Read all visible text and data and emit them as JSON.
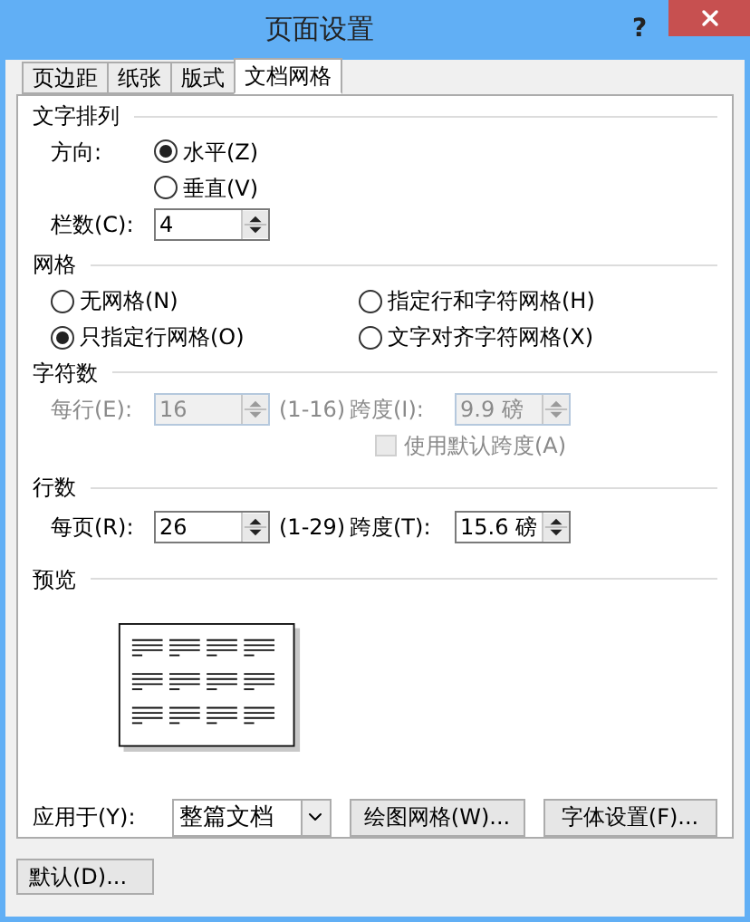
{
  "window": {
    "title": "页面设置",
    "help": "?"
  },
  "tabs": [
    {
      "label": "页边距",
      "selected": false
    },
    {
      "label": "纸张",
      "selected": false
    },
    {
      "label": "版式",
      "selected": false
    },
    {
      "label": "文档网格",
      "selected": true
    }
  ],
  "text_direction": {
    "heading": "文字排列",
    "direction_label": "方向:",
    "options": [
      {
        "label": "水平(Z)",
        "selected": true
      },
      {
        "label": "垂直(V)",
        "selected": false
      }
    ],
    "columns_label": "栏数(C):",
    "columns_value": "4"
  },
  "grid": {
    "heading": "网格",
    "options": [
      {
        "label": "无网格(N)",
        "selected": false
      },
      {
        "label": "指定行和字符网格(H)",
        "selected": false
      },
      {
        "label": "只指定行网格(O)",
        "selected": true
      },
      {
        "label": "文字对齐字符网格(X)",
        "selected": false
      }
    ]
  },
  "characters": {
    "heading": "字符数",
    "count_label": "每行(E):",
    "count_value": "16",
    "range": "(1-16)",
    "pitch_label": "跨度(I):",
    "pitch_value": "9.9 磅",
    "disabled": true,
    "default_pitch": {
      "label": "使用默认跨度(A)",
      "checked": false,
      "disabled": true
    }
  },
  "lines": {
    "heading": "行数",
    "count_label": "每页(R):",
    "count_value": "26",
    "range": "(1-29)",
    "pitch_label": "跨度(T):",
    "pitch_value": "15.6 磅",
    "disabled": false
  },
  "preview": {
    "heading": "预览"
  },
  "apply": {
    "label": "应用于(Y):",
    "value": "整篇文档"
  },
  "buttons": [
    "绘图网格(W)...",
    "字体设置(F)..."
  ],
  "default_button": "默认(D)..."
}
